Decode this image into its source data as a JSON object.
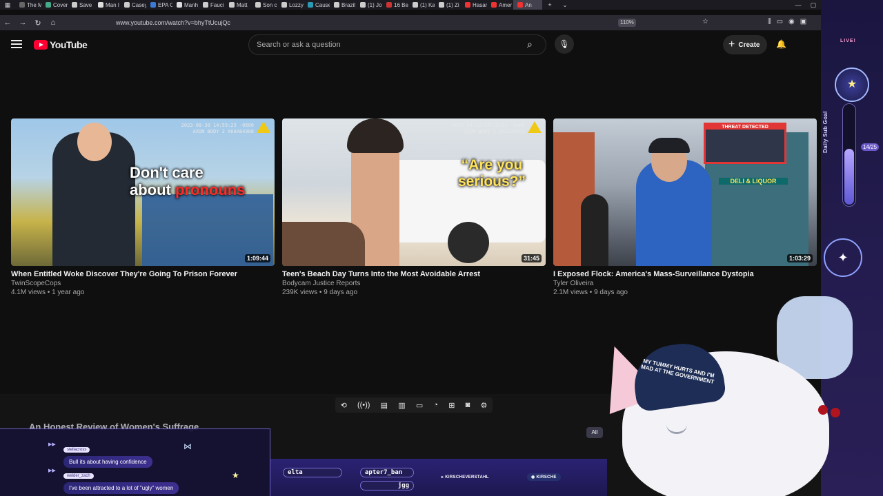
{
  "browser": {
    "tabs": [
      "The M",
      "Cover",
      "Save",
      "Man I",
      "Casey",
      "EPA C",
      "Manh",
      "Fauci",
      "Matt",
      "Son c",
      "Lozzy",
      "Cause",
      "Brazil",
      "(1) Jo",
      "16 Be",
      "(1) Ka",
      "(1) Zi",
      "Hasan",
      "Amer",
      "An"
    ],
    "url": "www.youtube.com/watch?v=bhyTtUcujQc",
    "zoom": "110%"
  },
  "header": {
    "logo_text": "YouTube",
    "search_placeholder": "Search or ask a question",
    "create_label": "Create"
  },
  "videos": [
    {
      "title": "When Entitled Woke Discover They're Going To Prison Forever",
      "channel": "TwinScopeCops",
      "meta": "4.1M views • 1 year ago",
      "duration": "1:09:44",
      "overlay_line1": "Don't care",
      "overlay_line2": "about ",
      "overlay_line2_hl": "pronouns",
      "stamp": "2023-08-30 14:59:23 -0600\nAXON BODY 3 X60A84988",
      "colors": {
        "sky": "#9fc7e8",
        "ground": "#c7b34a",
        "hl": "#ff2a2a"
      }
    },
    {
      "title": "Teen's Beach Day Turns Into the Most Avoidable Arrest",
      "channel": "Bodycam Justice Reports",
      "meta": "239K views • 9 days ago",
      "duration": "31:45",
      "overlay": "“Are you serious?”",
      "stamp": "2025-04-15 15:10:11 -0400\nAXON BODY 4 D01A10243",
      "colors": {
        "sky": "#cfd6dc",
        "ground": "#efe6d7",
        "hl": "#ffe35a"
      }
    },
    {
      "title": "I Exposed Flock: America's Mass-Surveillance Dystopia",
      "channel": "Tyler Oliveira",
      "meta": "2.1M views • 9 days ago",
      "duration": "1:03:29",
      "sign1": "THREAT DETECTED",
      "sign2": "DELI & LIQUOR",
      "colors": {
        "sky": "#b9c3cf",
        "ground": "#5d646f",
        "hl": "#e23636"
      }
    }
  ],
  "shelf": {
    "title": "An Honest Review of Women's Suffrage"
  },
  "all_chip": "All",
  "overlay": {
    "live": "LIVE!",
    "sub_goal_label": "Daily Sub Goal",
    "sub_goal_count": "14/25",
    "sub_goal_fraction": 0.56,
    "chat": [
      {
        "user": "stellacross",
        "text": "Bull its about having confidence"
      },
      {
        "user": "welder_zach",
        "text": "I've been attracted to a lot of \"ugly\" women"
      }
    ],
    "ticker_left": "elta",
    "ticker_mid": "apter7_ban",
    "ticker_mid2": "jgg",
    "socials": [
      "KIRSCHEVERSTAHL",
      "KIRSCHE"
    ],
    "cap_text": "MY TUMMY HURTS AND I'M MAD AT THE GOVERNMENT"
  }
}
